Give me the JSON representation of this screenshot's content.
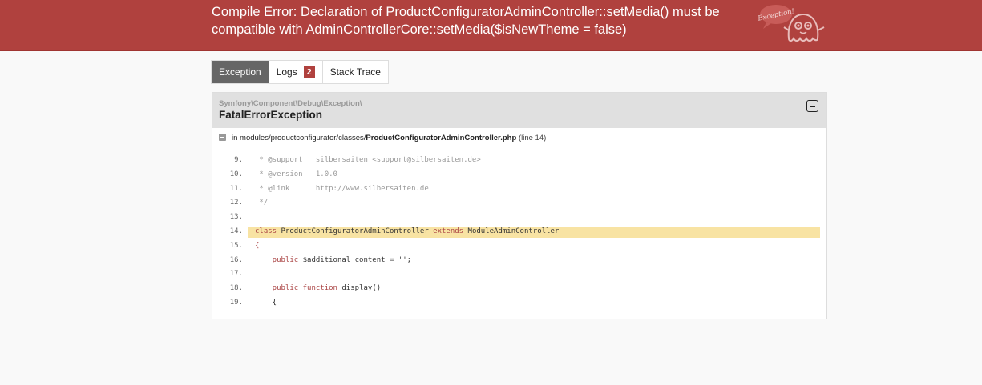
{
  "header": {
    "title_line1": "Compile Error: Declaration of ProductConfiguratorAdminController::setMedia() must be",
    "title_line2": "compatible with AdminControllerCore::setMedia($isNewTheme = false)",
    "mascot_label": "Exception!"
  },
  "tabs": [
    {
      "label": "Exception",
      "active": true
    },
    {
      "label": "Logs",
      "badge": "2",
      "active": false
    },
    {
      "label": "Stack Trace",
      "active": false
    }
  ],
  "exception": {
    "namespace": "Symfony\\Component\\Debug\\Exception\\",
    "class": "FatalErrorException",
    "location_prefix": "in modules/productconfigurator/classes/",
    "file": "ProductConfiguratorAdminController.php",
    "line_info": "(line 14)"
  },
  "code": [
    {
      "num": "9.",
      "text": " * @support   silbersaiten <support@silbersaiten.de>",
      "kind": "comment"
    },
    {
      "num": "10.",
      "text": " * @version   1.0.0",
      "kind": "comment"
    },
    {
      "num": "11.",
      "text": " * @link      http://www.silbersaiten.de",
      "kind": "comment"
    },
    {
      "num": "12.",
      "text": " */",
      "kind": "comment"
    },
    {
      "num": "13.",
      "text": "",
      "kind": "plain"
    },
    {
      "num": "14.",
      "kind": "highlight",
      "parts": [
        "class",
        " ProductConfiguratorAdminController ",
        "extends",
        " ModuleAdminController"
      ]
    },
    {
      "num": "15.",
      "text": "{",
      "kind": "brace"
    },
    {
      "num": "16.",
      "kind": "member",
      "parts": [
        "    public",
        " $additional_content = '';"
      ]
    },
    {
      "num": "17.",
      "text": "",
      "kind": "plain"
    },
    {
      "num": "18.",
      "kind": "method",
      "parts": [
        "    public",
        " function",
        " display()"
      ]
    },
    {
      "num": "19.",
      "text": "    {",
      "kind": "plain"
    }
  ],
  "colors": {
    "header_bg": "#b0413e",
    "highlight_bg": "#f8e3a3",
    "active_tab_bg": "#666666",
    "badge_bg": "#b0413e"
  }
}
